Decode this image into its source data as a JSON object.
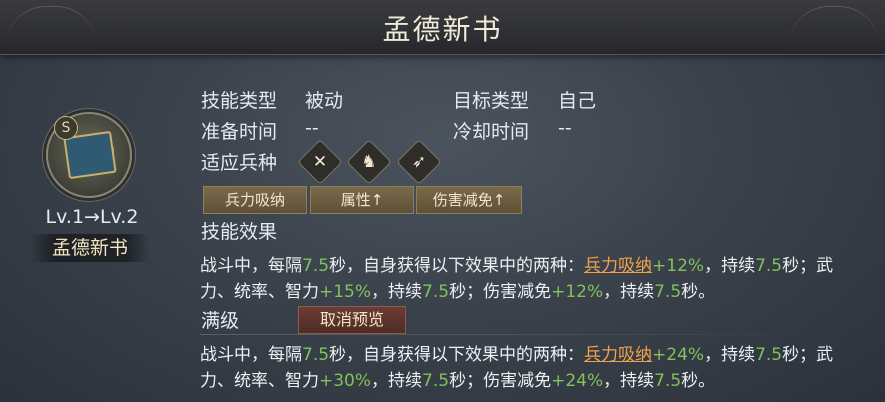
{
  "title": "孟德新书",
  "emblem": {
    "rank": "S"
  },
  "level_text": "Lv.1→Lv.2",
  "skill_name": "孟德新书",
  "info": {
    "skill_type_label": "技能类型",
    "skill_type_value": "被动",
    "target_type_label": "目标类型",
    "target_type_value": "自己",
    "prep_time_label": "准备时间",
    "prep_time_value": "--",
    "cooldown_label": "冷却时间",
    "cooldown_value": "--",
    "troop_label": "适应兵种",
    "troop_icons": [
      "crossed-spears-icon",
      "horse-icon",
      "bow-icon"
    ]
  },
  "tags": [
    "兵力吸纳",
    "属性↑",
    "伤害减免↑"
  ],
  "effect": {
    "title": "技能效果",
    "p1": "战斗中，每隔",
    "interval": "7.5",
    "p2": "秒，自身获得以下效果中的两种：",
    "link": "兵力吸纳",
    "absorb": "+12%",
    "p3": "，持续",
    "dur1": "7.5",
    "p4": "秒；武力、统率、智力",
    "stat": "+15%",
    "p5": "，持续",
    "dur2": "7.5",
    "p6": "秒；伤害减免",
    "reduce": "+12%",
    "p7": "，持续",
    "dur3": "7.5",
    "p8": "秒。"
  },
  "max": {
    "title": "满级",
    "cancel_preview": "取消预览",
    "p1": "战斗中，每隔",
    "interval": "7.5",
    "p2": "秒，自身获得以下效果中的两种：",
    "link": "兵力吸纳",
    "absorb": "+24%",
    "p3": "，持续",
    "dur1": "7.5",
    "p4": "秒；武力、统率、智力",
    "stat": "+30%",
    "p5": "，持续",
    "dur2": "7.5",
    "p6": "秒；伤害减免",
    "reduce": "+24%",
    "p7": "，持续",
    "dur3": "7.5",
    "p8": "秒。"
  }
}
